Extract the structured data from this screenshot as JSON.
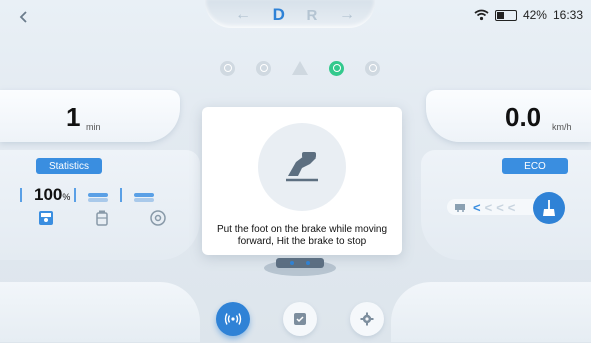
{
  "topbar": {
    "gears": {
      "forward_arrow": "←",
      "drive": "D",
      "reverse": "R",
      "back_arrow": "→"
    },
    "status": {
      "battery_pct": "42%",
      "time": "16:33",
      "battery_fill": 0.42
    }
  },
  "left": {
    "time_value": "1",
    "time_unit": "min",
    "tab_label": "Statistics",
    "percent_value": "100",
    "percent_unit": "%"
  },
  "right": {
    "speed_value": "0.0",
    "speed_unit": "km/h",
    "mode_label": "ECO"
  },
  "modal": {
    "text": "Put the foot on the brake while moving forward, Hit the brake to stop"
  },
  "colors": {
    "accent": "#2f82d6",
    "active_light": "#33c98d"
  },
  "icons": {
    "back": "chevron-left-icon",
    "wifi": "wifi-icon",
    "battery": "battery-icon",
    "nav": [
      "broadcast-icon",
      "checklist-icon",
      "gear-icon"
    ],
    "modal": "foot-brake-icon"
  }
}
